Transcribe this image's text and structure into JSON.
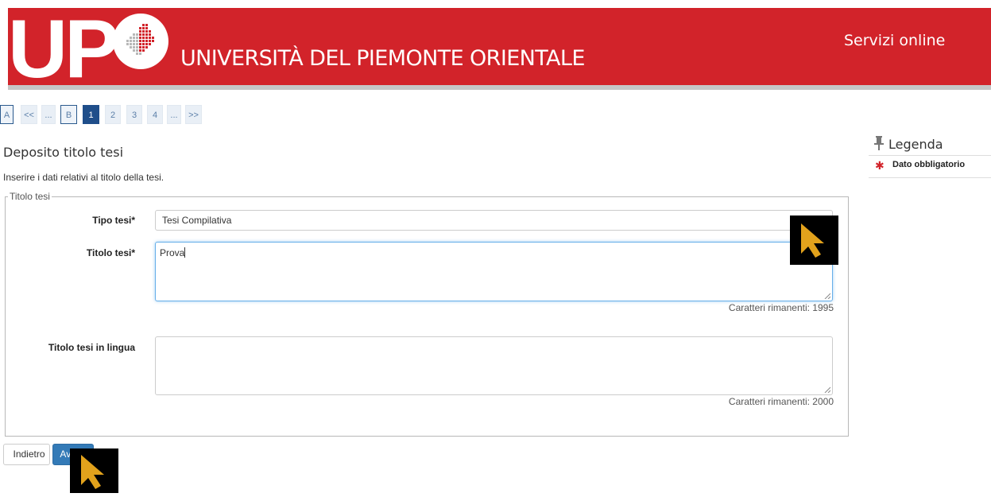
{
  "header": {
    "logo_letters": "UP",
    "university_name": "UNIVERSITÀ DEL PIEMONTE ORIENTALE",
    "services_link": "Servizi online",
    "brand_color": "#d2232a"
  },
  "pager": {
    "items": [
      "A",
      "<<",
      "...",
      "B",
      "1",
      "2",
      "3",
      "4",
      "...",
      ">>"
    ],
    "active": "1"
  },
  "page": {
    "title": "Deposito titolo tesi",
    "intro": "Inserire i dati relativi al titolo della tesi."
  },
  "form": {
    "legend": "Titolo tesi",
    "tipo_tesi": {
      "label": "Tipo tesi*",
      "value": "Tesi Compilativa"
    },
    "titolo_tesi": {
      "label": "Titolo tesi*",
      "value": "Prova",
      "remaining": "Caratteri rimanenti: 1995"
    },
    "titolo_lingua": {
      "label": "Titolo tesi in lingua",
      "value": "",
      "remaining": "Caratteri rimanenti: 2000"
    }
  },
  "buttons": {
    "back": "Indietro",
    "next": "Avanti"
  },
  "legend_panel": {
    "title": "Legenda",
    "items": [
      {
        "icon": "asterisk-icon",
        "label": "Dato obbligatorio"
      }
    ]
  },
  "icons": [
    "pin-icon",
    "asterisk-icon",
    "cursor-icon",
    "resize-grip-icon",
    "logo-seal-icon"
  ],
  "colors": {
    "accent": "#337ab7",
    "pager_active": "#1f4e8a",
    "required": "#d2232a",
    "cursor": "#e2a21c"
  }
}
